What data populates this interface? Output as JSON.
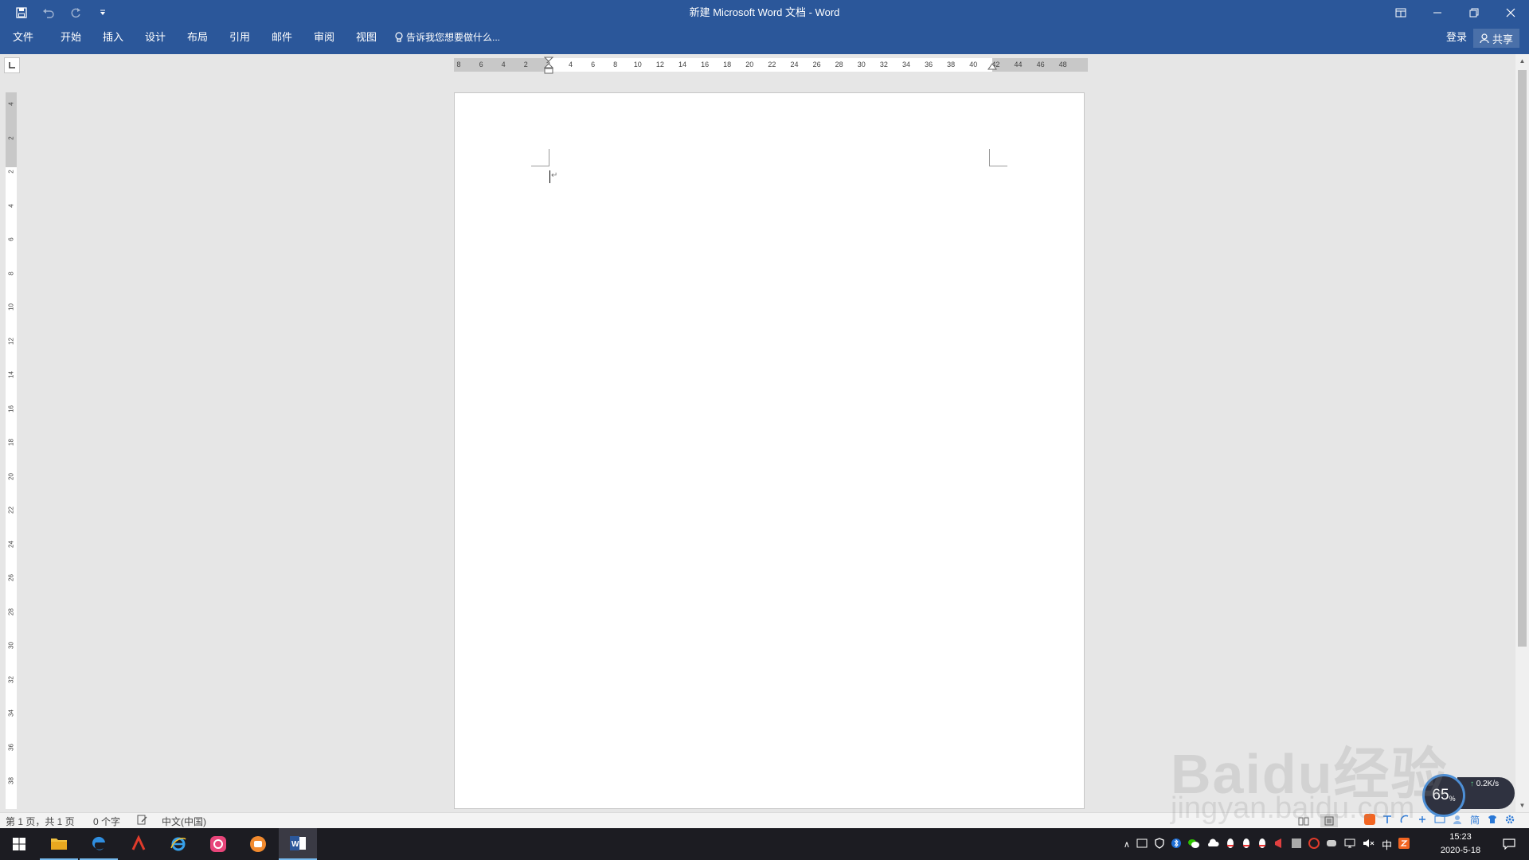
{
  "window": {
    "title": "新建 Microsoft Word 文档 - Word"
  },
  "ribbon": {
    "tabs": [
      {
        "label": "文件"
      },
      {
        "label": "开始"
      },
      {
        "label": "插入"
      },
      {
        "label": "设计"
      },
      {
        "label": "布局"
      },
      {
        "label": "引用"
      },
      {
        "label": "邮件"
      },
      {
        "label": "审阅"
      },
      {
        "label": "视图"
      }
    ],
    "tell_me": "告诉我您想要做什么...",
    "login": "登录",
    "share": "共享"
  },
  "ruler": {
    "horizontal_ticks": [
      "8",
      "6",
      "4",
      "2",
      "2",
      "4",
      "6",
      "8",
      "10",
      "12",
      "14",
      "16",
      "18",
      "20",
      "22",
      "24",
      "26",
      "28",
      "30",
      "32",
      "34",
      "36",
      "38",
      "40",
      "42",
      "44",
      "46",
      "48"
    ],
    "vertical_ticks": [
      "4",
      "2",
      "2",
      "4",
      "6",
      "8",
      "10",
      "12",
      "14",
      "16",
      "18",
      "20",
      "22",
      "24",
      "26",
      "28",
      "30",
      "32",
      "34",
      "36",
      "38"
    ]
  },
  "statusbar": {
    "page": "第 1 页，共 1 页",
    "words": "0 个字",
    "language": "中文(中国)"
  },
  "taskbar": {
    "apps": [
      {
        "name": "file-explorer"
      },
      {
        "name": "edge"
      },
      {
        "name": "wps"
      },
      {
        "name": "internet-explorer"
      },
      {
        "name": "app-pink"
      },
      {
        "name": "app-orange"
      },
      {
        "name": "word"
      }
    ],
    "ime_label": "中",
    "time": "15:23",
    "date": "2020-5-18"
  },
  "net_widget": {
    "percent": "65",
    "percent_unit": "%",
    "upload": "0.2K/s"
  },
  "ime_toolbar": {
    "simplified": "简"
  },
  "watermark": {
    "brand": "Baidu经验",
    "url": "jingyan.baidu.com"
  },
  "colors": {
    "ribbon": "#2b579a",
    "taskbar": "#1c1c22",
    "canvas": "#e6e6e6"
  }
}
